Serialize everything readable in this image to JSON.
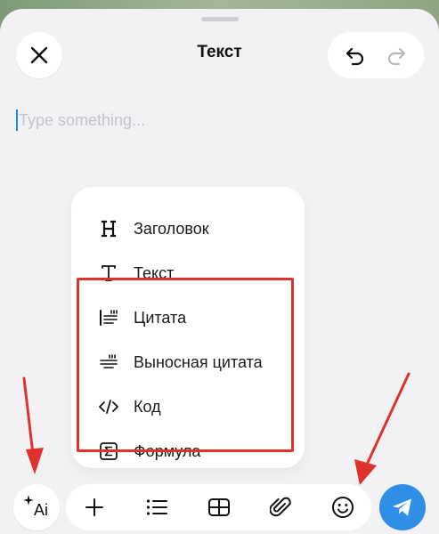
{
  "header": {
    "title": "Текст",
    "close_icon": "close-icon",
    "undo_icon": "undo-icon",
    "redo_icon": "redo-icon"
  },
  "editor": {
    "placeholder": "Type something..."
  },
  "insert_menu": {
    "items": [
      {
        "label": "Заголовок",
        "icon": "heading-icon"
      },
      {
        "label": "Текст",
        "icon": "text-icon"
      },
      {
        "label": "Цитата",
        "icon": "quote-icon"
      },
      {
        "label": "Выносная цитата",
        "icon": "pull-quote-icon"
      },
      {
        "label": "Код",
        "icon": "code-icon"
      },
      {
        "label": "Формула",
        "icon": "formula-icon"
      }
    ]
  },
  "toolbar": {
    "ai_label": "Ai",
    "items": [
      "plus-icon",
      "list-icon",
      "table-icon",
      "attachment-icon",
      "emoji-icon"
    ],
    "send_icon": "send-icon"
  },
  "colors": {
    "accent": "#2f8fe6",
    "annotation": "#e0322c",
    "sheet_background": "#f2f2f4",
    "placeholder": "#c4c4c8"
  }
}
